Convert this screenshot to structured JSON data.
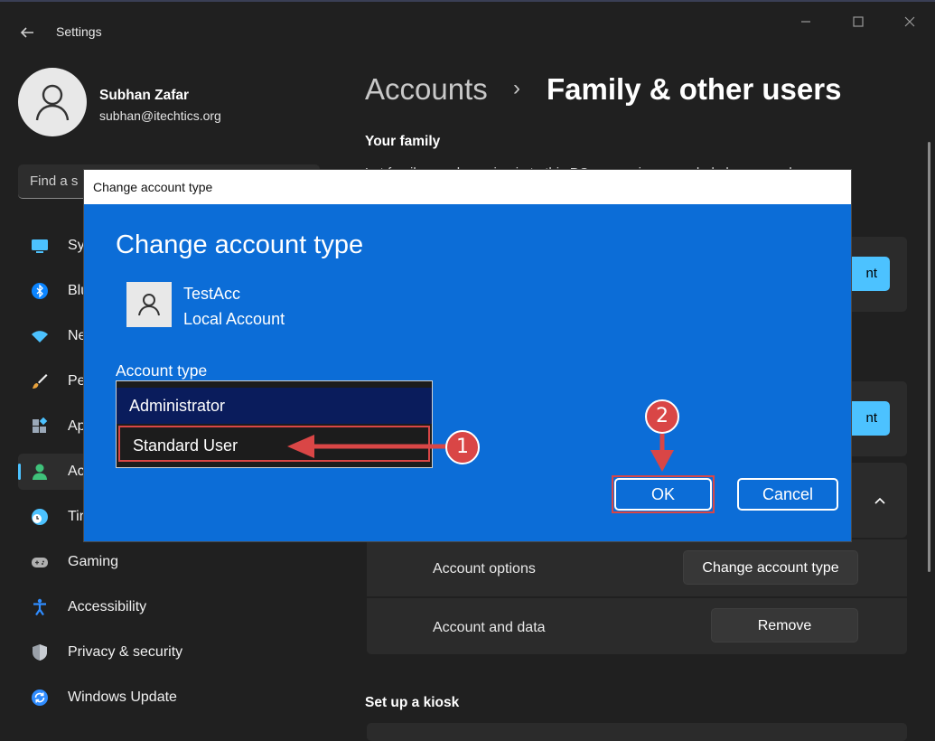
{
  "app": {
    "title": "Settings",
    "back_icon": "arrow-left-icon",
    "window_controls": [
      "minimize-icon",
      "maximize-icon",
      "close-icon"
    ]
  },
  "profile": {
    "name": "Subhan Zafar",
    "email": "subhan@itechtics.org"
  },
  "search": {
    "placeholder": "Find a s"
  },
  "nav": {
    "items": [
      {
        "label": "Sy",
        "icon": "display-icon",
        "color": "#4cc2ff"
      },
      {
        "label": "Blu",
        "icon": "bluetooth-icon",
        "color": "#0a84ff"
      },
      {
        "label": "Ne",
        "icon": "wifi-icon",
        "color": "#4cc2ff"
      },
      {
        "label": "Pe",
        "icon": "brush-icon",
        "color": "#e8a23c"
      },
      {
        "label": "Ap",
        "icon": "apps-icon",
        "color": "#9aa8b8"
      },
      {
        "label": "Ac",
        "icon": "person-icon",
        "color": "#3fc27a",
        "active": true
      },
      {
        "label": "Tir",
        "icon": "clock-globe-icon",
        "color": "#4cc2ff"
      },
      {
        "label": "Gaming",
        "icon": "gamepad-icon",
        "color": "#b0b0b0"
      },
      {
        "label": "Accessibility",
        "icon": "accessibility-icon",
        "color": "#2f8cff"
      },
      {
        "label": "Privacy & security",
        "icon": "shield-icon",
        "color": "#9aa0a8"
      },
      {
        "label": "Windows Update",
        "icon": "update-icon",
        "color": "#2f8cff"
      }
    ]
  },
  "content": {
    "breadcrumb_parent": "Accounts",
    "breadcrumb_sep": "›",
    "breadcrumb_current": "Family & other users",
    "your_family_title": "Your family",
    "your_family_desc": "Let family members sign in to this PC – organizers can help keep members",
    "add_family_btn_tail": "nt",
    "add_other_btn_tail": "nt",
    "account_options_label": "Account options",
    "change_account_type_btn": "Change account type",
    "account_data_label": "Account and data",
    "remove_btn": "Remove",
    "kiosk_title": "Set up a kiosk"
  },
  "dialog": {
    "title": "Change account type",
    "heading": "Change account type",
    "account_name": "TestAcc",
    "account_kind": "Local Account",
    "account_type_label": "Account type",
    "options": [
      "Administrator",
      "Standard User"
    ],
    "selected_option": "Administrator",
    "ok_label": "OK",
    "cancel_label": "Cancel",
    "accent_color": "#0c6dd7"
  },
  "annotations": {
    "step1": "1",
    "step2": "2",
    "color": "#d94646"
  }
}
